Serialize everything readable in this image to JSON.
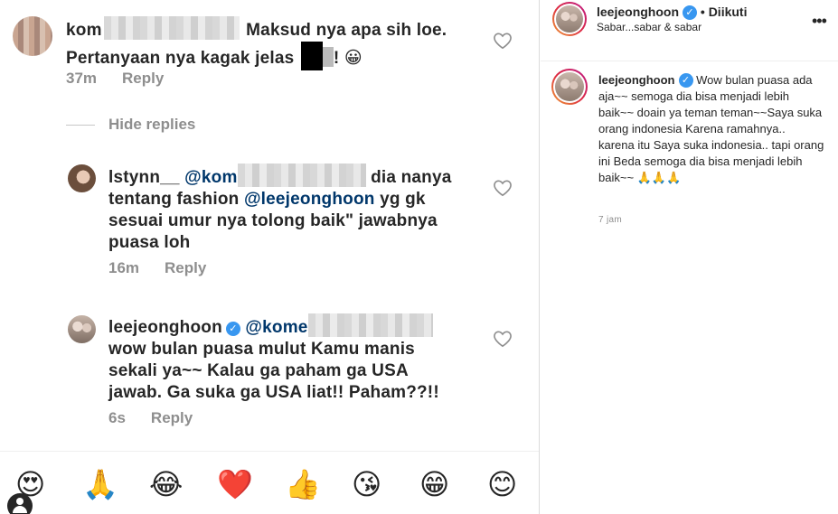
{
  "comments": {
    "main": {
      "username": "kom",
      "text": "Maksud nya apa sih loe. Pertanyaan nya kagak jelas",
      "text_line1": "Maksud nya apa sih loe.",
      "text_line2": "Pertanyaan nya kagak jelas",
      "text_tail": "!",
      "emoji": "😀",
      "time": "37m",
      "reply_label": "Reply"
    },
    "hide_replies_label": "Hide replies",
    "replies": [
      {
        "username": "lstynn__",
        "mention1": "@kom",
        "line1_tail": "dia nanya",
        "line2_head": "tentang fashion",
        "mention2": "@leejeonghoon",
        "line2_tail": "yg gk",
        "line3": "sesuai umur nya tolong baik\" jawabnya",
        "line4": "puasa loh",
        "time": "16m",
        "reply_label": "Reply"
      },
      {
        "username": "leejeonghoon",
        "mention1": "@kome",
        "line2": "wow bulan puasa mulut Kamu manis",
        "line3": "sekali ya~~ Kalau ga paham ga USA",
        "line4": "jawab. Ga suka ga USA liat!! Paham??!!",
        "time": "6s",
        "reply_label": "Reply"
      }
    ]
  },
  "emoji_bar": [
    "😍",
    "🙏",
    "😂",
    "❤️",
    "👍",
    "😘",
    "😁",
    "😊"
  ],
  "post": {
    "username": "leejeonghoon",
    "separator": "•",
    "follow_status": "Diikuti",
    "subtitle": "Sabar...sabar & sabar",
    "more_label": "•••",
    "caption_user": "leejeonghoon",
    "caption": "Wow bulan puasa ada aja~~ semoga dia bisa menjadi lebih baik~~ doain ya teman teman~~Saya suka orang indonesia Karena ramahnya.. karena itu Saya suka indonesia.. tapi orang ini Beda semoga dia bisa menjadi lebih baik~~ 🙏🙏🙏",
    "time": "7 jam"
  },
  "colors": {
    "text": "#262626",
    "muted": "#8e8e8e",
    "mention": "#00376b",
    "verified": "#3897f0",
    "heart_red": "#ed4956"
  }
}
